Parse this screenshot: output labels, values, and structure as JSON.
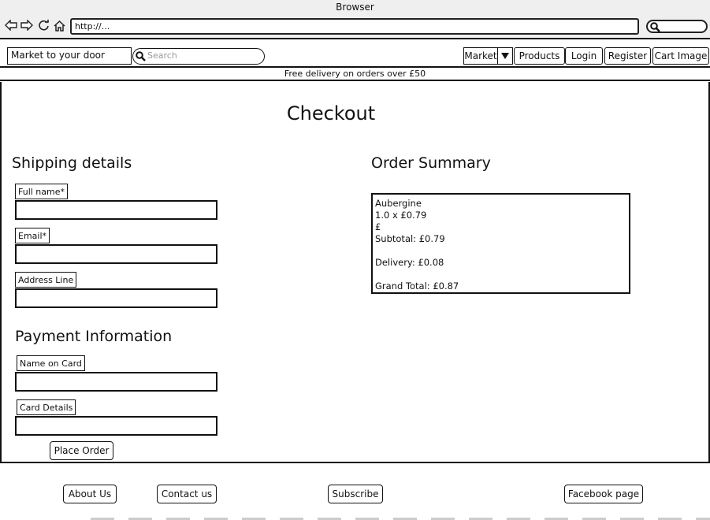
{
  "browser": {
    "title": "Browser",
    "url": "http://..."
  },
  "header": {
    "brand": "Market to your door",
    "search_placeholder": "Search",
    "nav": {
      "market": "Market",
      "products": "Products",
      "login": "Login",
      "register": "Register",
      "cart": "Cart Image"
    }
  },
  "promo": "Free delivery on orders over £50",
  "page_title": "Checkout",
  "shipping": {
    "heading": "Shipping details",
    "full_name_label": "Full name*",
    "email_label": "Email*",
    "address_label": "Address Line"
  },
  "payment": {
    "heading": "Payment Information",
    "name_on_card_label": "Name on Card",
    "card_details_label": "Card Details",
    "place_order": "Place Order"
  },
  "summary": {
    "heading": "Order Summary",
    "item_name": "Aubergine",
    "item_qty_price": "1.0 x £0.79",
    "item_line_total": "£",
    "subtotal": "Subtotal: £0.79",
    "delivery": "Delivery: £0.08",
    "grand_total": "Grand Total: £0.87"
  },
  "footer": {
    "about": "About Us",
    "contact": "Contact us",
    "subscribe": "Subscribe",
    "facebook": "Facebook page"
  }
}
